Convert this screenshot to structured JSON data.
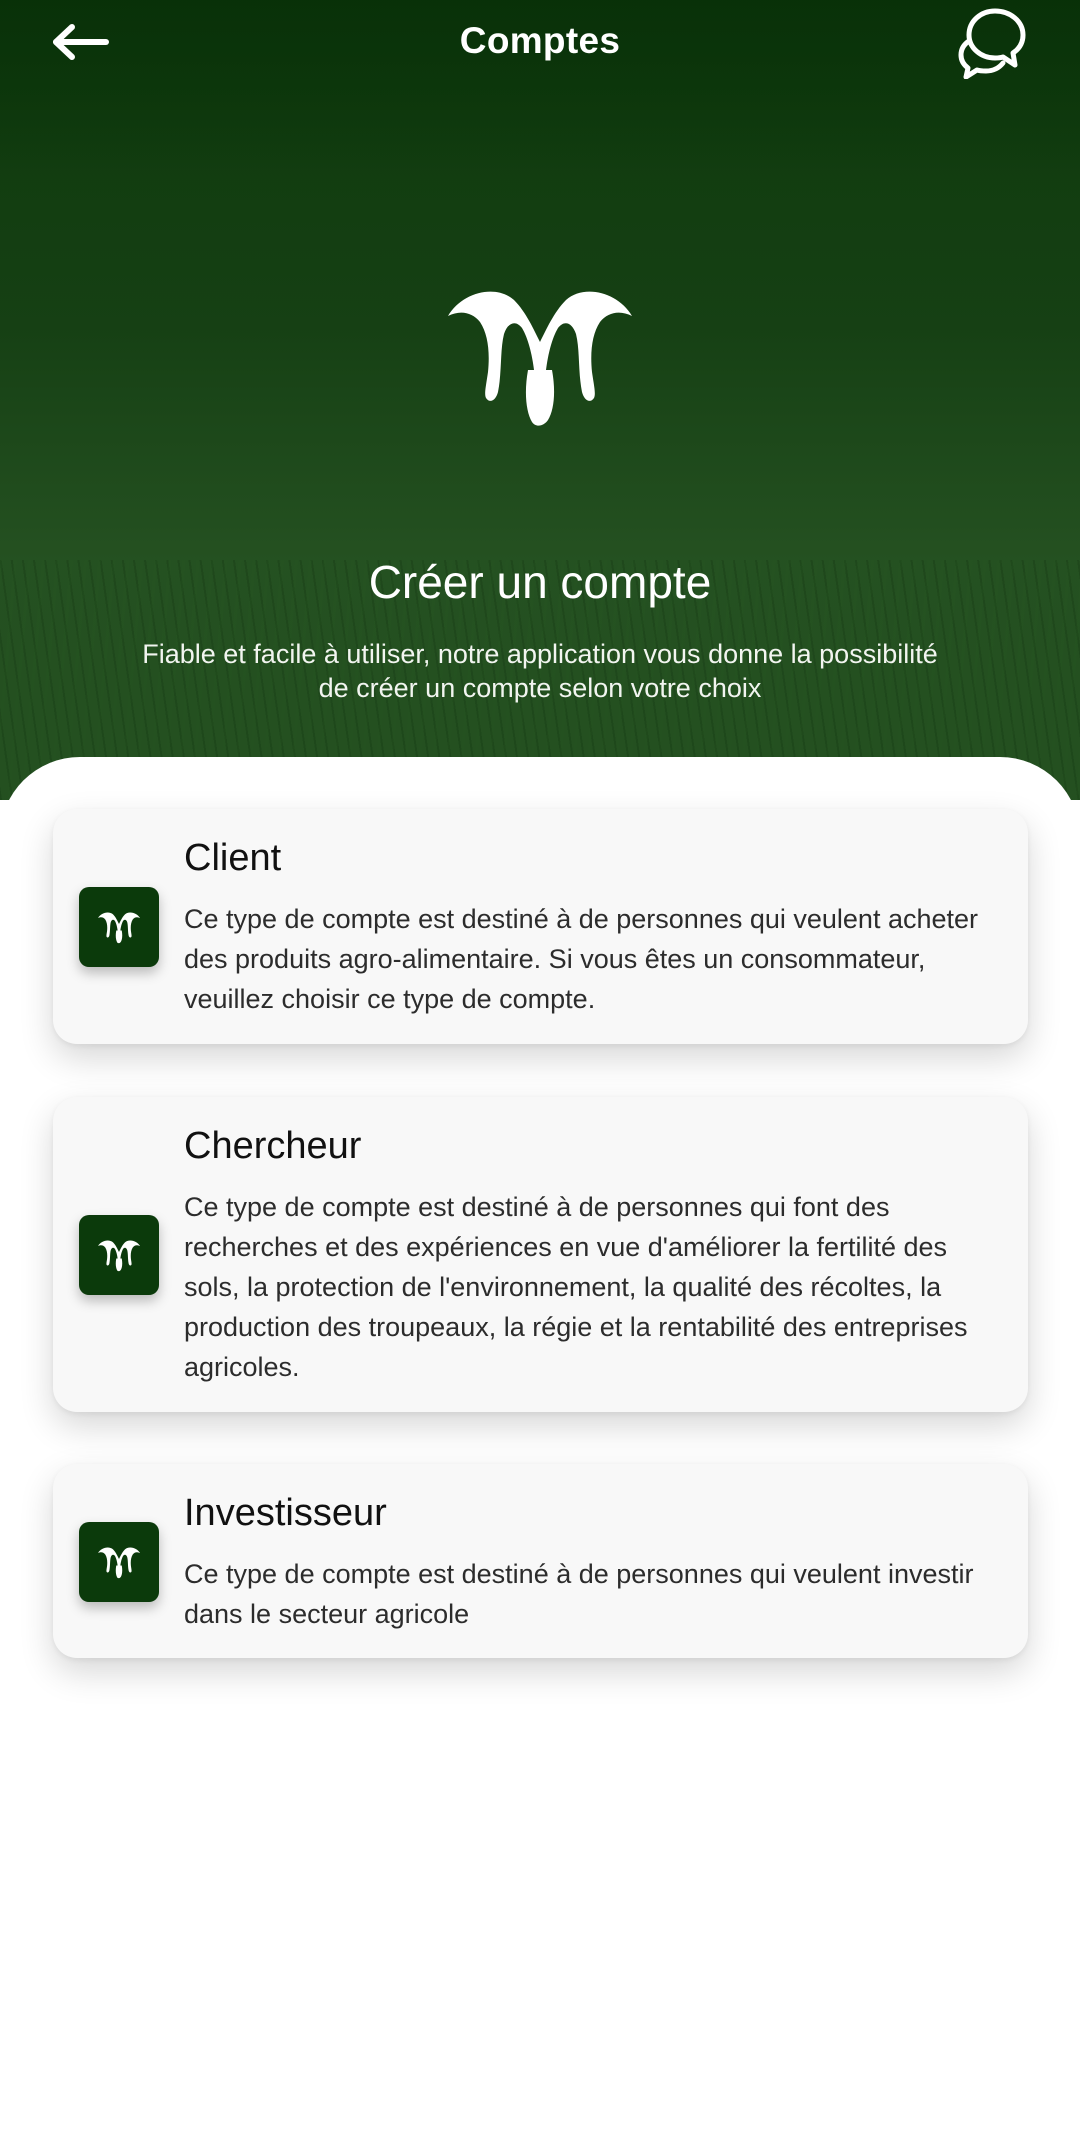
{
  "header": {
    "title": "Comptes",
    "back_icon": "arrow-left-icon",
    "chat_icon": "chat-bubbles-icon"
  },
  "hero": {
    "logo_icon": "brand-logo-icon",
    "heading": "Créer un compte",
    "description": "Fiable et facile à utiliser, notre application vous donne la possibilité de créer un compte selon votre choix"
  },
  "accounts": [
    {
      "title": "Client",
      "description": "Ce type de compte est destiné à de personnes qui veulent acheter des produits agro-alimentaire. Si vous êtes un consommateur, veuillez choisir ce type de compte.",
      "icon": "brand-logo-icon"
    },
    {
      "title": "Chercheur",
      "description": "Ce type de compte est destiné à de personnes qui font des recherches et des expériences en vue d'améliorer la fertilité des sols, la protection de l'environnement, la qualité des récoltes, la production des troupeaux, la régie et la rentabilité des entreprises agricoles.",
      "icon": "brand-logo-icon"
    },
    {
      "title": "Investisseur",
      "description": "Ce type de compte est destiné à de personnes qui veulent investir dans le secteur agricole",
      "icon": "brand-logo-icon"
    }
  ],
  "colors": {
    "brand_green": "#0b3a0b",
    "card_bg": "#f8f8f8",
    "text_dark": "#111111"
  }
}
